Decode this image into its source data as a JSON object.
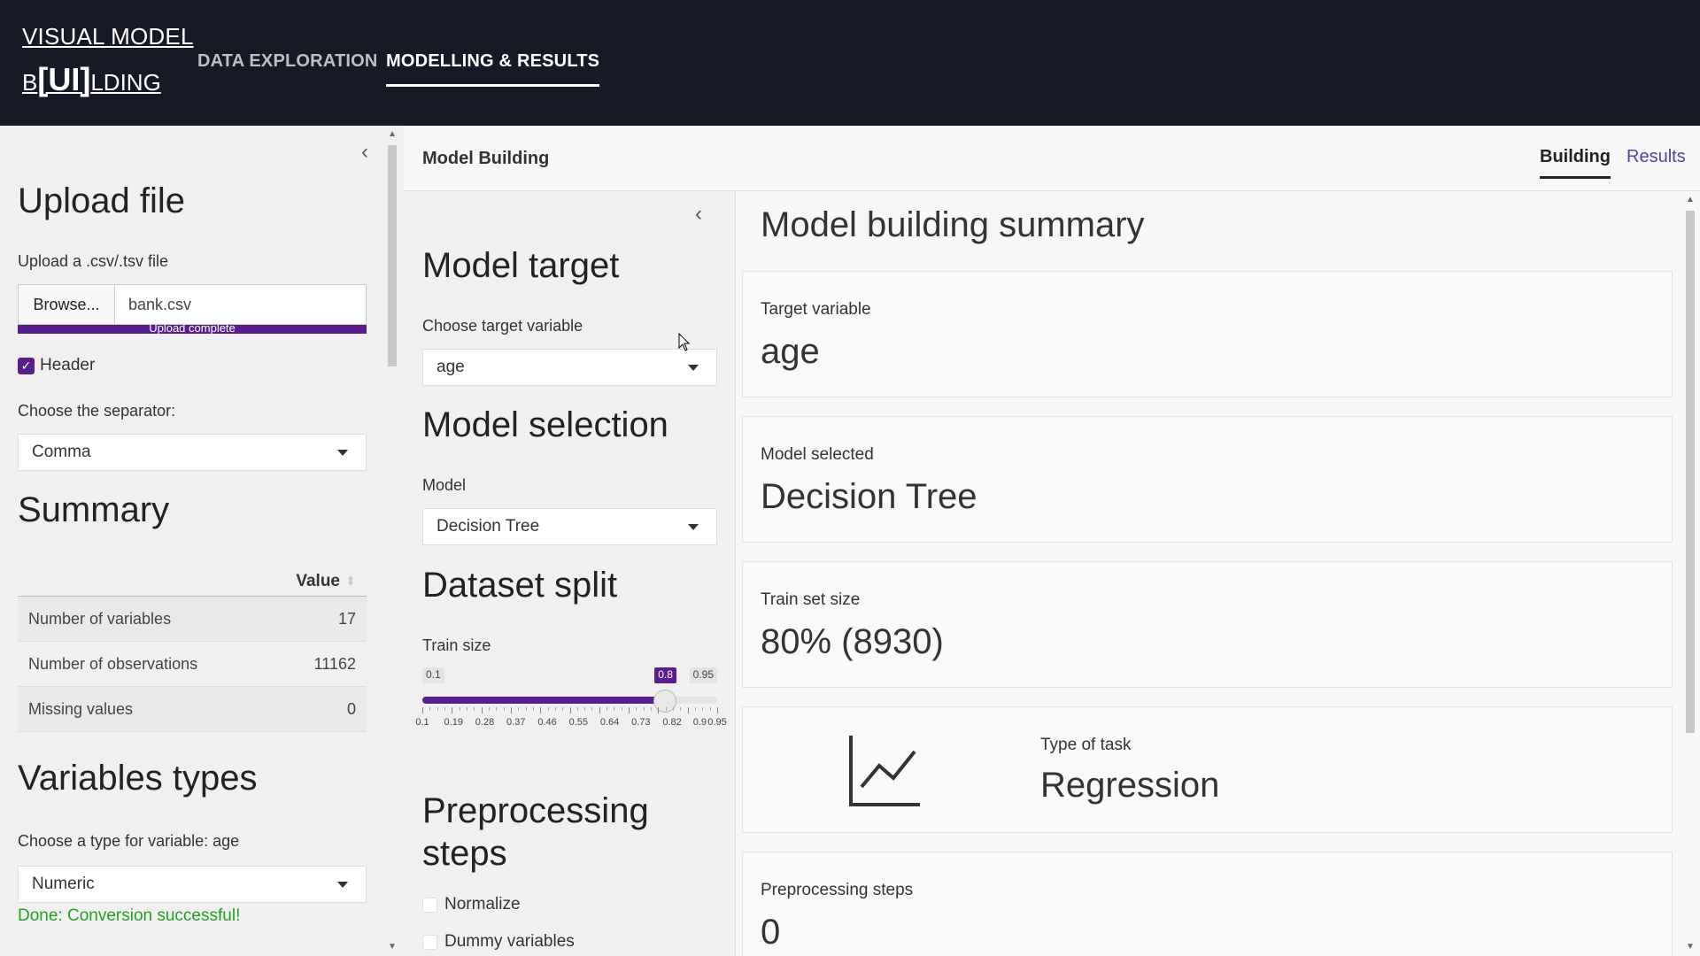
{
  "navbar": {
    "brand_line1": "VISUAL MODEL",
    "brand_line2_pre": "B",
    "brand_line2_ui": "[UI]",
    "brand_line2_post": "LDING",
    "tabs": [
      {
        "label": "DATA EXPLORATION",
        "active": false
      },
      {
        "label": "MODELLING & RESULTS",
        "active": true
      }
    ]
  },
  "sidebar": {
    "upload_title": "Upload file",
    "upload_label": "Upload a .csv/.tsv file",
    "browse_label": "Browse...",
    "file_name": "bank.csv",
    "upload_progress": 1.0,
    "upload_status": "Upload complete",
    "header_checkbox": {
      "label": "Header",
      "checked": true
    },
    "separator_label": "Choose the separator:",
    "separator_value": "Comma",
    "summary_title": "Summary",
    "summary_table": {
      "column_header": "Value",
      "rows": [
        {
          "key": "Number of variables",
          "value": "17"
        },
        {
          "key": "Number of observations",
          "value": "11162"
        },
        {
          "key": "Missing values",
          "value": "0"
        }
      ]
    },
    "variables_title": "Variables types",
    "variable_type_label": "Choose a type for variable: age",
    "variable_type_value": "Numeric",
    "conversion_status": "Done: Conversion successful!"
  },
  "main": {
    "title": "Model Building",
    "tabs": [
      {
        "label": "Building",
        "active": true
      },
      {
        "label": "Results",
        "active": false
      }
    ],
    "controls": {
      "target_title": "Model target",
      "target_label": "Choose target variable",
      "target_value": "age",
      "model_title": "Model selection",
      "model_label": "Model",
      "model_value": "Decision Tree",
      "split_title": "Dataset split",
      "train_label": "Train size",
      "slider": {
        "min": 0.1,
        "max": 0.95,
        "value": 0.8,
        "min_label": "0.1",
        "max_label": "0.95",
        "value_label": "0.8",
        "tick_labels": [
          "0.1",
          "0.19",
          "0.28",
          "0.37",
          "0.46",
          "0.55",
          "0.64",
          "0.73",
          "0.82",
          "0.9",
          "0.95"
        ]
      },
      "preprocessing_title_1": "Preprocessing",
      "preprocessing_title_2": "steps",
      "options": [
        {
          "label": "Normalize",
          "checked": false
        },
        {
          "label": "Dummy variables",
          "checked": false
        }
      ]
    },
    "summary": {
      "title": "Model building summary",
      "cards": [
        {
          "label": "Target variable",
          "value": "age"
        },
        {
          "label": "Model selected",
          "value": "Decision Tree"
        },
        {
          "label": "Train set size",
          "value": "80% (8930)"
        },
        {
          "label": "Type of task",
          "value": "Regression",
          "icon": "line-chart-icon"
        },
        {
          "label": "Preprocessing steps",
          "value": "0"
        }
      ]
    }
  },
  "colors": {
    "navbar_bg": "#171a26",
    "accent": "#5a1e8c",
    "success": "#22a022",
    "link": "#5a3ea6"
  }
}
